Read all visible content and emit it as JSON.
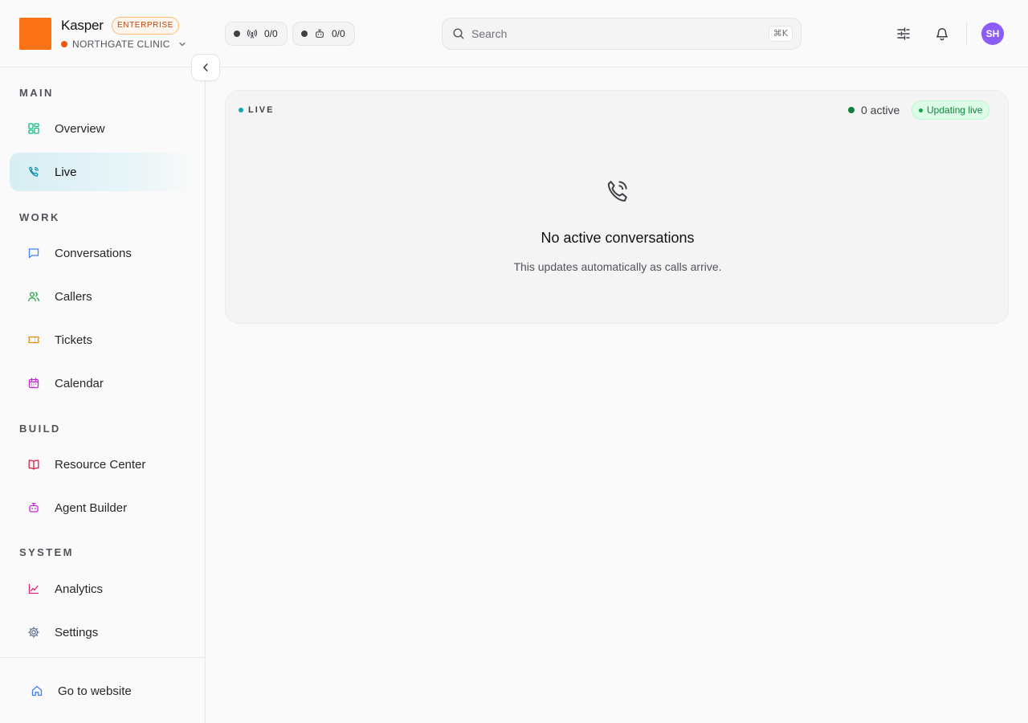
{
  "header": {
    "brand_name": "Kasper",
    "plan_badge": "ENTERPRISE",
    "org_name": "NORTHGATE CLINIC",
    "calls_status": "0/0",
    "agents_status": "0/0",
    "search_placeholder": "Search",
    "search_shortcut": "⌘K",
    "avatar_initials": "SH"
  },
  "sidebar": {
    "sections": {
      "main": "MAIN",
      "work": "WORK",
      "build": "BUILD",
      "system": "SYSTEM"
    },
    "items": [
      {
        "label": "Overview",
        "icon": "grid-icon",
        "color": "#10b981"
      },
      {
        "label": "Live",
        "icon": "phone-call-icon",
        "color": "#0891b2",
        "active": true
      },
      {
        "label": "Conversations",
        "icon": "message-square-icon",
        "color": "#3b82f6"
      },
      {
        "label": "Callers",
        "icon": "users-icon",
        "color": "#22a34a"
      },
      {
        "label": "Tickets",
        "icon": "ticket-icon",
        "color": "#ea8a0c"
      },
      {
        "label": "Calendar",
        "icon": "calendar-icon",
        "color": "#c026d3"
      },
      {
        "label": "Resource Center",
        "icon": "book-open-icon",
        "color": "#e11d48"
      },
      {
        "label": "Agent Builder",
        "icon": "bot-icon",
        "color": "#c026d3"
      },
      {
        "label": "Analytics",
        "icon": "line-chart-icon",
        "color": "#db2777"
      },
      {
        "label": "Settings",
        "icon": "gear-icon",
        "color": "#64748b"
      }
    ],
    "footer_link": {
      "label": "Go to website",
      "icon": "home-icon",
      "color": "#3b82f6"
    }
  },
  "live_panel": {
    "tag": "LIVE",
    "active_count": "0 active",
    "updating_badge": "Updating live",
    "empty_title": "No active conversations",
    "empty_subtitle": "This updates automatically as calls arrive."
  },
  "colors": {
    "brand": "#f97316",
    "accent": "#0891b2",
    "live_green": "#15803d",
    "avatar": "#8b5cf6"
  }
}
